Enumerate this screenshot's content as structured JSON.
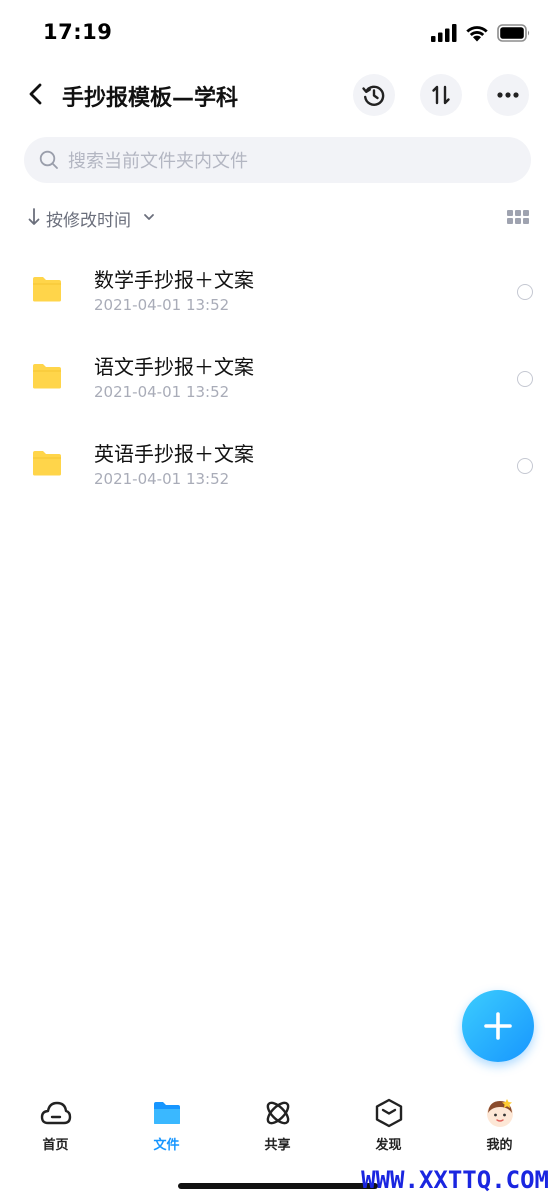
{
  "status_bar": {
    "time": "17:19"
  },
  "nav": {
    "title": "手抄报模板—学科"
  },
  "search": {
    "placeholder": "搜索当前文件夹内文件"
  },
  "sort": {
    "label": "按修改时间"
  },
  "files": [
    {
      "name": "数学手抄报＋文案",
      "date": "2021-04-01 13:52"
    },
    {
      "name": "语文手抄报＋文案",
      "date": "2021-04-01 13:52"
    },
    {
      "name": "英语手抄报＋文案",
      "date": "2021-04-01 13:52"
    }
  ],
  "tabs": [
    {
      "label": "首页",
      "icon": "cloud-icon"
    },
    {
      "label": "文件",
      "icon": "folder-icon",
      "active": true
    },
    {
      "label": "共享",
      "icon": "atom-icon"
    },
    {
      "label": "发现",
      "icon": "cube-icon"
    },
    {
      "label": "我的",
      "icon": "avatar"
    }
  ],
  "watermark": "WWW.XXTTQ.COM",
  "colors": {
    "accent": "#1796ff",
    "folder": "#ffd54a",
    "search_bg": "#f2f3f7"
  }
}
